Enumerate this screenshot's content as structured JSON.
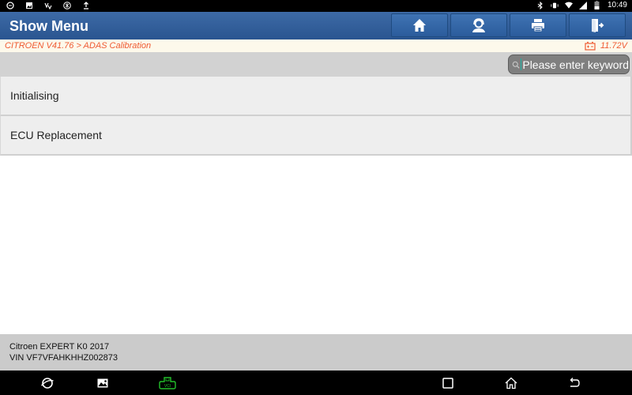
{
  "status_bar": {
    "left_icons": [
      "chat-bubble-icon",
      "image-icon",
      "usb-icon",
      "cpu-icon",
      "upload-icon"
    ],
    "right_icons": [
      "bluetooth-icon",
      "vibrate-icon",
      "wifi-icon",
      "signal-icon",
      "battery-icon"
    ],
    "time": "10:49"
  },
  "header": {
    "title": "Show Menu",
    "buttons": [
      {
        "name": "home",
        "icon": "home-icon"
      },
      {
        "name": "support",
        "icon": "headset-user-icon"
      },
      {
        "name": "print",
        "icon": "printer-icon"
      },
      {
        "name": "exit",
        "icon": "exit-door-icon"
      }
    ]
  },
  "breadcrumb": {
    "path": "CITROEN V41.76 > ADAS Calibration",
    "voltage": "11.72V",
    "accent_color": "#ef5a32"
  },
  "search": {
    "placeholder": "Please enter keyword",
    "value": ""
  },
  "menu": {
    "items": [
      {
        "label": "Initialising"
      },
      {
        "label": "ECU Replacement"
      }
    ]
  },
  "footer": {
    "vehicle": "Citroen EXPERT K0 2017",
    "vin": "VIN VF7VFAHKHHZ002873"
  },
  "nav_bar": {
    "left": [
      "browser-icon",
      "gallery-icon",
      "vci-icon"
    ],
    "right": [
      "recent-apps-icon",
      "home-icon",
      "back-icon"
    ],
    "vci_color": "#22c02a"
  }
}
